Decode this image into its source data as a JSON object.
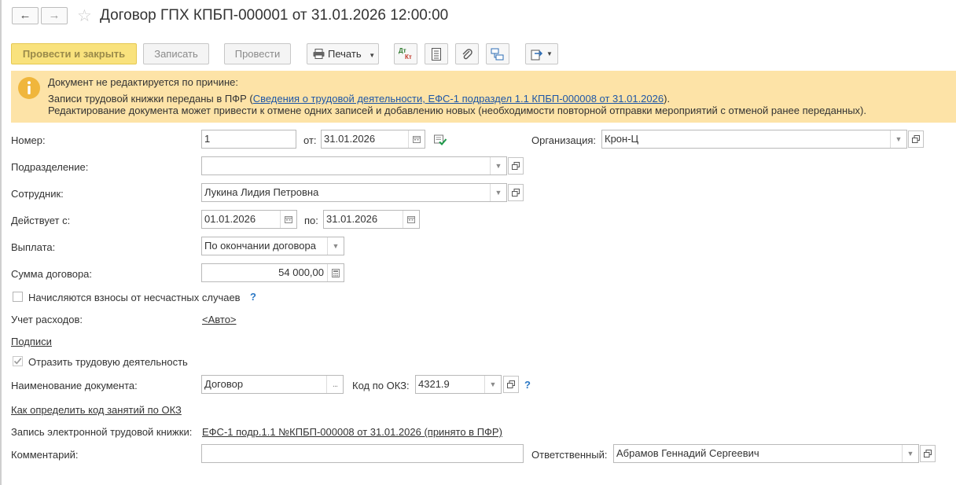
{
  "header": {
    "title": "Договор ГПХ КПБП-000001 от 31.01.2026 12:00:00",
    "back_icon": "arrow-left-icon",
    "forward_icon": "arrow-right-icon",
    "favorite_icon": "star-icon"
  },
  "toolbar": {
    "post_close": "Провести и закрыть",
    "save": "Записать",
    "post": "Провести",
    "print": "Печать",
    "dt_label": "Дт",
    "kt_label": "Кт"
  },
  "warning": {
    "line1": "Документ не редактируется по причине:",
    "line2_prefix": "Записи трудовой книжки переданы в ПФР (",
    "line2_link": "Сведения о трудовой деятельности, ЕФС-1 подраздел 1.1 КПБП-000008 от 31.01.2026",
    "line2_suffix": ").",
    "line3": "Редактирование документа может привести к отмене одних записей и добавлению новых (необходимости повторной отправки мероприятий с отменой ранее переданных).",
    "icon": "info-icon"
  },
  "form": {
    "number_label": "Номер:",
    "number_value": "1",
    "date_label": "от:",
    "date_value": "31.01.2026",
    "org_label": "Организация:",
    "org_value": "Крон-Ц",
    "dept_label": "Подразделение:",
    "dept_value": "",
    "employee_label": "Сотрудник:",
    "employee_value": "Лукина Лидия Петровна",
    "valid_from_label": "Действует с:",
    "valid_from_value": "01.01.2026",
    "valid_to_label": "по:",
    "valid_to_value": "31.01.2026",
    "payment_label": "Выплата:",
    "payment_value": "По окончании договора",
    "amount_label": "Сумма договора:",
    "amount_value": "54 000,00",
    "accident_label": "Начисляются взносы от несчастных случаев",
    "accident_checked": false,
    "expense_label": "Учет расходов:",
    "expense_value": "<Авто>",
    "signatures_link": "Подписи",
    "labor_label": "Отразить трудовую деятельность",
    "labor_checked": true,
    "docname_label": "Наименование документа:",
    "docname_value": "Договор",
    "okz_label": "Код по ОКЗ:",
    "okz_value": "4321.9",
    "okz_help_link": "Как определить код занятий по ОКЗ",
    "etk_label": "Запись электронной трудовой книжки:",
    "etk_link": "ЕФС-1 подр.1.1 №КПБП-000008 от 31.01.2026 (принято в ПФР)",
    "comment_label": "Комментарий:",
    "comment_value": "",
    "responsible_label": "Ответственный:",
    "responsible_value": "Абрамов Геннадий Сергеевич",
    "help_mark": "?"
  },
  "colors": {
    "primary_button": "#f9e27d",
    "warning_bg": "#fde3a7",
    "link": "#1f57a6",
    "green_link": "#0f7a42"
  }
}
